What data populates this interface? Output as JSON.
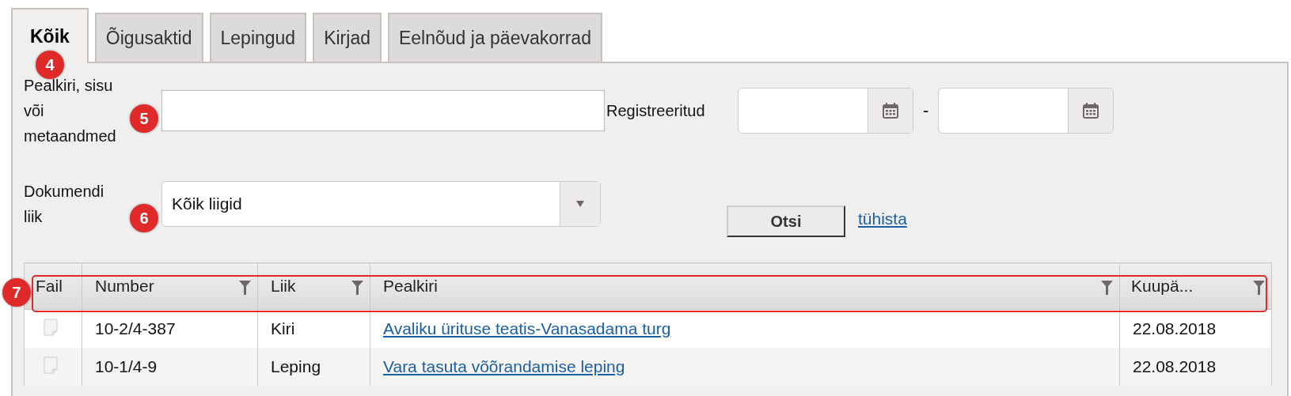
{
  "tabs": [
    {
      "label": "Kõik",
      "selected": true
    },
    {
      "label": "Õigusaktid",
      "selected": false
    },
    {
      "label": "Lepingud",
      "selected": false
    },
    {
      "label": "Kirjad",
      "selected": false
    },
    {
      "label": "Eelnõud ja päevakorrad",
      "selected": false
    }
  ],
  "search_form": {
    "text_label": "Pealkiri, sisu või metaandmed",
    "registered_label": "Registreeritud",
    "date_separator": "-",
    "type_label": "Dokumendi liik",
    "type_value": "Kõik liigid",
    "search_button": "Otsi",
    "clear_link": "tühista"
  },
  "table": {
    "columns": [
      {
        "label": "Fail",
        "filter": false
      },
      {
        "label": "Number",
        "filter": true
      },
      {
        "label": "Liik",
        "filter": true
      },
      {
        "label": "Pealkiri",
        "filter": true
      },
      {
        "label": "Kuupä...",
        "filter": true
      }
    ],
    "rows": [
      {
        "number": "10-2/4-387",
        "type": "Kiri",
        "title": "Avaliku ürituse teatis-Vanasadama turg",
        "date": "22.08.2018"
      },
      {
        "number": "10-1/4-9",
        "type": "Leping",
        "title": "Vara tasuta võõrandamise leping",
        "date": "22.08.2018"
      }
    ]
  },
  "callouts": [
    {
      "number": "4"
    },
    {
      "number": "5"
    },
    {
      "number": "6"
    },
    {
      "number": "7"
    }
  ]
}
